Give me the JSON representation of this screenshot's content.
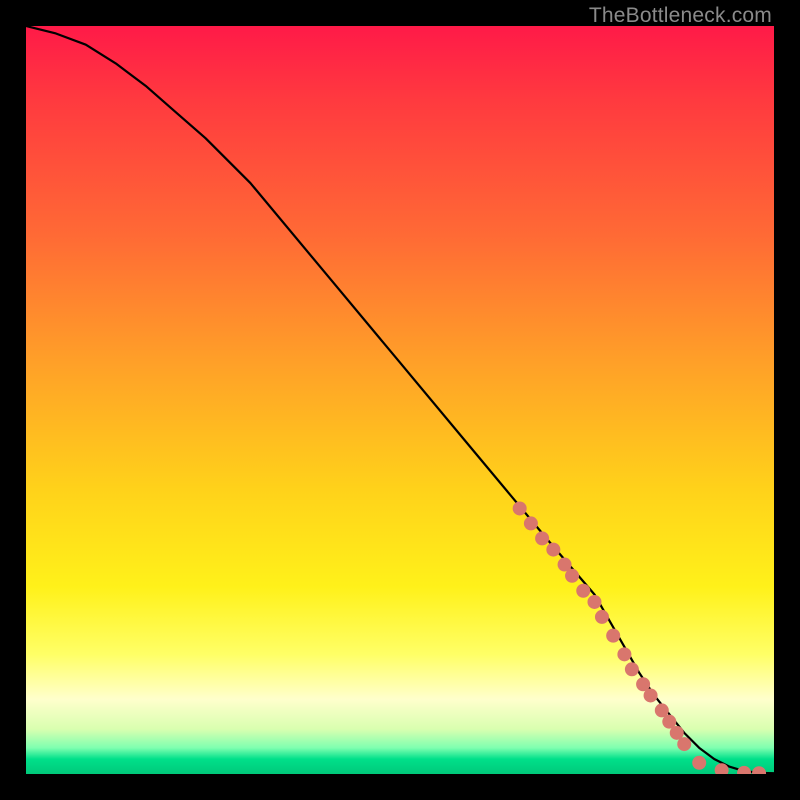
{
  "watermark": "TheBottleneck.com",
  "chart_data": {
    "type": "line",
    "title": "",
    "xlabel": "",
    "ylabel": "",
    "xlim": [
      0,
      100
    ],
    "ylim": [
      0,
      100
    ],
    "series": [
      {
        "name": "curve",
        "x": [
          0,
          4,
          8,
          12,
          16,
          20,
          24,
          30,
          40,
          50,
          60,
          70,
          76,
          80,
          82,
          84,
          86,
          88,
          90,
          92,
          94,
          96,
          98,
          100
        ],
        "y": [
          100,
          99,
          97.5,
          95,
          92,
          88.5,
          85,
          79,
          67,
          55,
          43,
          31,
          24,
          17,
          13.5,
          10.5,
          8,
          5.5,
          3.5,
          2,
          1,
          0.4,
          0.15,
          0.1
        ]
      }
    ],
    "markers": {
      "name": "dots",
      "color": "#d9766d",
      "radius_px": 7,
      "x": [
        66,
        67.5,
        69,
        70.5,
        72,
        73,
        74.5,
        76,
        77,
        78.5,
        80,
        81,
        82.5,
        83.5,
        85,
        86,
        87,
        88,
        90,
        93,
        96,
        98
      ],
      "y": [
        35.5,
        33.5,
        31.5,
        30,
        28,
        26.5,
        24.5,
        23,
        21,
        18.5,
        16,
        14,
        12,
        10.5,
        8.5,
        7,
        5.5,
        4,
        1.5,
        0.5,
        0.15,
        0.1
      ]
    },
    "background_gradient": {
      "direction": "top-to-bottom",
      "stops": [
        {
          "pos": 0.0,
          "color": "#ff1a48"
        },
        {
          "pos": 0.3,
          "color": "#ff7a30"
        },
        {
          "pos": 0.6,
          "color": "#ffd21a"
        },
        {
          "pos": 0.85,
          "color": "#ffff88"
        },
        {
          "pos": 0.94,
          "color": "#d9ffb0"
        },
        {
          "pos": 1.0,
          "color": "#00c97a"
        }
      ]
    }
  }
}
